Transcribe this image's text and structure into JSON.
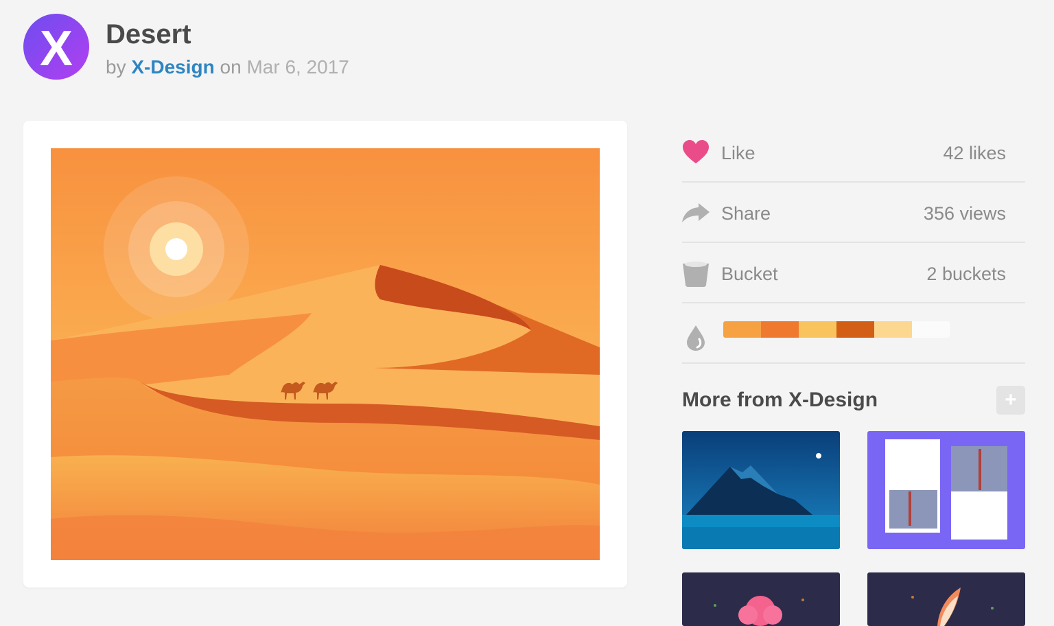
{
  "shot": {
    "title": "Desert",
    "by_label": "by",
    "author": "X-Design",
    "on_label": "on",
    "date": "Mar 6, 2017",
    "avatar_icon": "x-design-logo",
    "avatar_letter": "X"
  },
  "actions": [
    {
      "label": "Like",
      "count": "42 likes",
      "icon": "heart-icon",
      "color": "#ea4c89"
    },
    {
      "label": "Share",
      "count": "356 views",
      "icon": "share-arrow-icon",
      "color": "#b0b0b0"
    },
    {
      "label": "Bucket",
      "count": "2 buckets",
      "icon": "bucket-icon",
      "color": "#b0b0b0"
    }
  ],
  "palette": {
    "icon": "droplet-icon",
    "colors": [
      "#f6a243",
      "#ef7a2f",
      "#f9c35e",
      "#d35f16",
      "#fcd78f",
      "#fbfbfb"
    ]
  },
  "more": {
    "title": "More from X-Design",
    "add_label": "+",
    "thumbnails": [
      "Night mountain lake",
      "Golden Gate Bridge",
      "Pink cloud",
      "Rocket"
    ]
  }
}
